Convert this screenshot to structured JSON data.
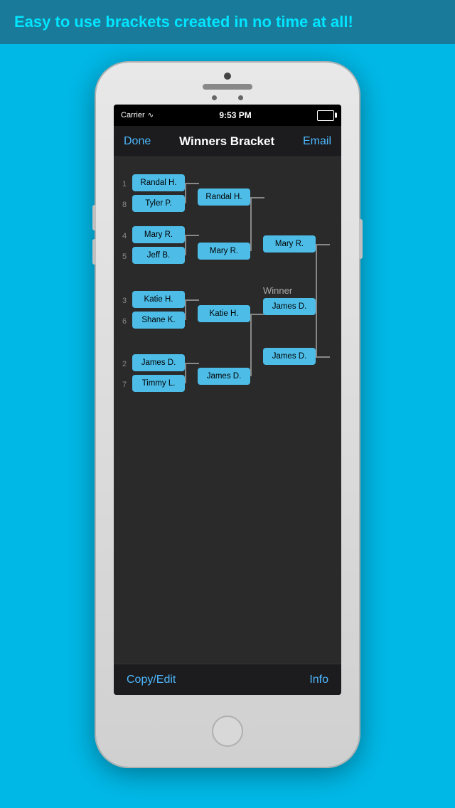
{
  "banner": {
    "text": "Easy to use brackets created in no time at all!"
  },
  "status_bar": {
    "carrier": "Carrier",
    "time": "9:53 PM"
  },
  "nav": {
    "done_label": "Done",
    "title": "Winners Bracket",
    "email_label": "Email"
  },
  "bottom_toolbar": {
    "copy_edit_label": "Copy/Edit",
    "info_label": "Info"
  },
  "bracket": {
    "seeds": [
      1,
      8,
      4,
      5,
      3,
      6,
      2,
      7
    ],
    "round1": [
      {
        "seed": 1,
        "name": "Randal H."
      },
      {
        "seed": 8,
        "name": "Tyler P."
      },
      {
        "seed": 4,
        "name": "Mary R."
      },
      {
        "seed": 5,
        "name": "Jeff B."
      },
      {
        "seed": 3,
        "name": "Katie H."
      },
      {
        "seed": 6,
        "name": "Shane K."
      },
      {
        "seed": 2,
        "name": "James D."
      },
      {
        "seed": 7,
        "name": "Timmy L."
      }
    ],
    "round2": [
      {
        "name": "Randal H."
      },
      {
        "name": "Mary R."
      },
      {
        "name": "Katie H."
      },
      {
        "name": "James D."
      }
    ],
    "round3": [
      {
        "name": "Mary R."
      },
      {
        "name": "James D."
      }
    ],
    "winner": {
      "label": "Winner",
      "name": "James D."
    }
  },
  "colors": {
    "bracket_box": "#4dbde8",
    "accent_blue": "#4db8ff",
    "bg_dark": "#2a2a2a",
    "nav_bg": "#1c1c1e",
    "banner_bg": "#1a7a99",
    "sky_blue": "#00b8e6"
  }
}
